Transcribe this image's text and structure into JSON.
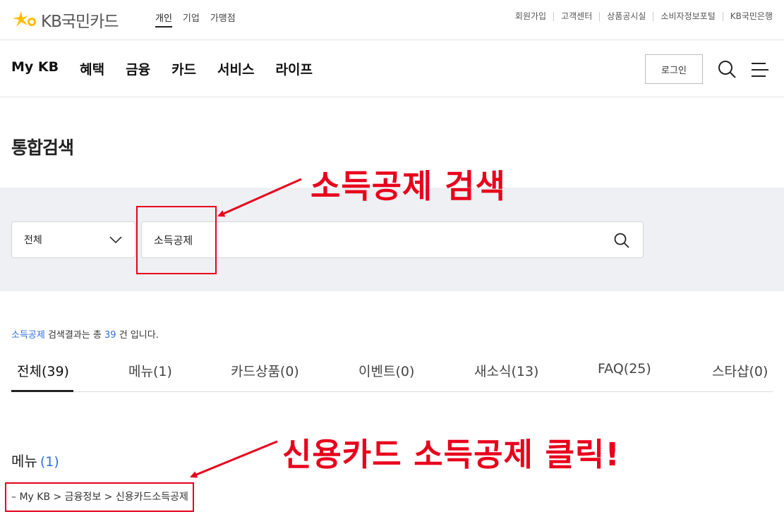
{
  "brand": {
    "name": "KB국민카드",
    "accent": "#ffbc00"
  },
  "segments": [
    {
      "label": "개인",
      "active": true
    },
    {
      "label": "기업",
      "active": false
    },
    {
      "label": "가맹점",
      "active": false
    }
  ],
  "util_links": [
    "회원가입",
    "고객센터",
    "상품공시실",
    "소비자정보포털",
    "KB국민은행"
  ],
  "gnb": [
    "My KB",
    "혜택",
    "금융",
    "카드",
    "서비스",
    "라이프"
  ],
  "login_label": "로그인",
  "page_title": "통합검색",
  "search": {
    "category": "전체",
    "query": "소득공제"
  },
  "result": {
    "keyword": "소득공제",
    "text1": " 검색결과는 총 ",
    "count": "39",
    "text2": " 건 입니다."
  },
  "tabs": [
    {
      "label": "전체(39)",
      "active": true
    },
    {
      "label": "메뉴(1)"
    },
    {
      "label": "카드상품(0)"
    },
    {
      "label": "이벤트(0)"
    },
    {
      "label": "새소식(13)"
    },
    {
      "label": "FAQ(25)"
    },
    {
      "label": "스타샵(0)"
    }
  ],
  "menu_section": {
    "title": "메뉴",
    "count": "(1)"
  },
  "breadcrumb": "My KB > 금융정보 > 신용카드소득공제",
  "annotations": {
    "top": "소득공제 검색",
    "bottom": "신용카드 소득공제 클릭!"
  },
  "colors": {
    "highlight": "#e8001c",
    "link": "#2f6fde",
    "search_bg": "#eef0f4"
  }
}
